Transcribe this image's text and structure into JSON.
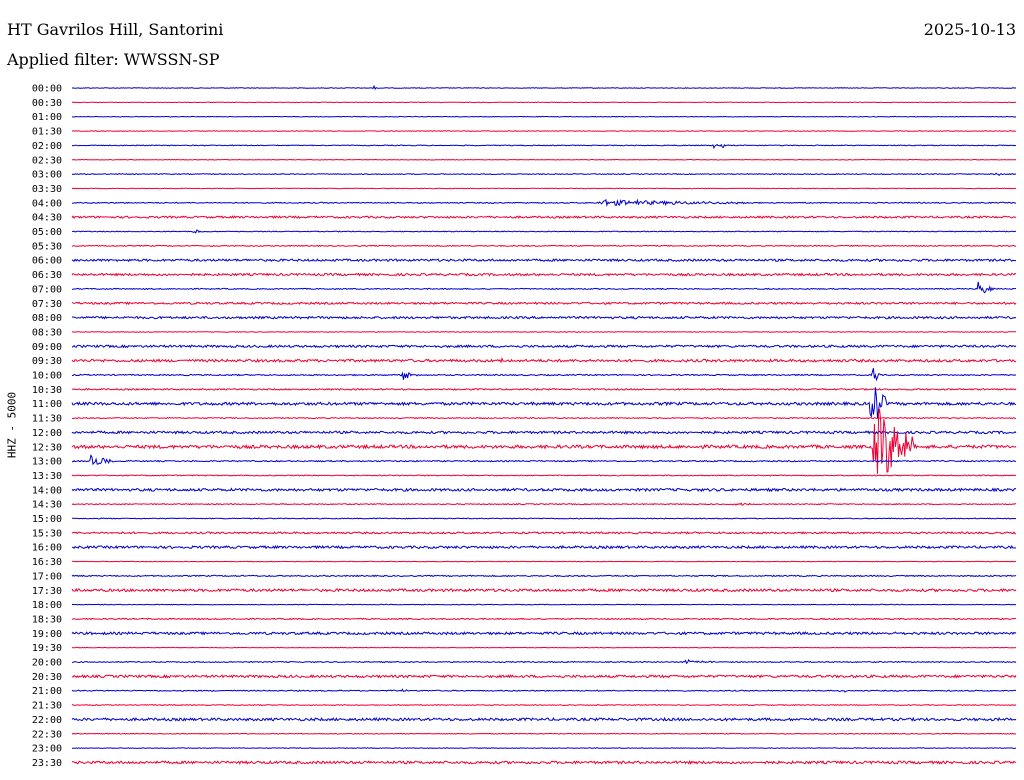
{
  "header": {
    "station": "HT Gavrilos Hill, Santorini",
    "date": "2025-10-13",
    "filter": "Applied filter: WWSSN-SP"
  },
  "chart_data": {
    "type": "line",
    "title": "HT Gavrilos Hill, Santorini",
    "ylabel": "HHZ - 5000",
    "colors": {
      "even": "#0000cc",
      "odd": "#ee0033"
    },
    "rows": [
      {
        "label": "00:00",
        "noise": 0.3,
        "events": [
          {
            "x": 0.32,
            "amp": 2,
            "dur": 0.005
          }
        ]
      },
      {
        "label": "00:30",
        "noise": 0.3,
        "events": []
      },
      {
        "label": "01:00",
        "noise": 0.3,
        "events": []
      },
      {
        "label": "01:30",
        "noise": 0.3,
        "events": []
      },
      {
        "label": "02:00",
        "noise": 0.4,
        "events": [
          {
            "x": 0.68,
            "amp": 3,
            "dur": 0.005
          },
          {
            "x": 0.688,
            "amp": 3,
            "dur": 0.005
          }
        ]
      },
      {
        "label": "02:30",
        "noise": 0.3,
        "events": []
      },
      {
        "label": "03:00",
        "noise": 0.4,
        "events": [
          {
            "x": 0.975,
            "amp": 3,
            "dur": 0.01
          }
        ]
      },
      {
        "label": "03:30",
        "noise": 0.3,
        "events": []
      },
      {
        "label": "04:00",
        "noise": 0.5,
        "events": [
          {
            "x": 0.56,
            "amp": 3,
            "dur": 0.16
          }
        ]
      },
      {
        "label": "04:30",
        "noise": 1.0,
        "events": []
      },
      {
        "label": "05:00",
        "noise": 0.4,
        "events": [
          {
            "x": 0.13,
            "amp": 3,
            "dur": 0.008
          }
        ]
      },
      {
        "label": "05:30",
        "noise": 0.5,
        "events": []
      },
      {
        "label": "06:00",
        "noise": 1.1,
        "events": []
      },
      {
        "label": "06:30",
        "noise": 1.1,
        "events": []
      },
      {
        "label": "07:00",
        "noise": 0.5,
        "events": [
          {
            "x": 0.96,
            "amp": 8,
            "dur": 0.015
          }
        ]
      },
      {
        "label": "07:30",
        "noise": 1.0,
        "events": []
      },
      {
        "label": "08:00",
        "noise": 1.1,
        "events": []
      },
      {
        "label": "08:30",
        "noise": 0.3,
        "events": []
      },
      {
        "label": "09:00",
        "noise": 1.1,
        "events": []
      },
      {
        "label": "09:30",
        "noise": 1.3,
        "events": [
          {
            "x": 0.455,
            "amp": 3,
            "dur": 0.005
          }
        ]
      },
      {
        "label": "10:00",
        "noise": 0.6,
        "events": [
          {
            "x": 0.35,
            "amp": 7,
            "dur": 0.012
          },
          {
            "x": 0.849,
            "amp": 28,
            "dur": 0.003
          }
        ]
      },
      {
        "label": "10:30",
        "noise": 0.7,
        "events": []
      },
      {
        "label": "11:00",
        "noise": 1.4,
        "events": [
          {
            "x": 0.847,
            "amp": 40,
            "dur": 0.012
          }
        ]
      },
      {
        "label": "11:30",
        "noise": 0.5,
        "events": []
      },
      {
        "label": "12:00",
        "noise": 1.2,
        "events": []
      },
      {
        "label": "12:30",
        "noise": 1.6,
        "events": [
          {
            "x": 0.85,
            "amp": 48,
            "dur": 0.04
          }
        ]
      },
      {
        "label": "13:00",
        "noise": 0.6,
        "events": [
          {
            "x": 0.02,
            "amp": 7,
            "dur": 0.02
          }
        ]
      },
      {
        "label": "13:30",
        "noise": 0.5,
        "events": []
      },
      {
        "label": "14:00",
        "noise": 1.3,
        "events": []
      },
      {
        "label": "14:30",
        "noise": 0.5,
        "events": [
          {
            "x": 0.7,
            "amp": 2,
            "dur": 0.02
          }
        ]
      },
      {
        "label": "15:00",
        "noise": 0.4,
        "events": []
      },
      {
        "label": "15:30",
        "noise": 0.9,
        "events": []
      },
      {
        "label": "16:00",
        "noise": 1.2,
        "events": []
      },
      {
        "label": "16:30",
        "noise": 0.3,
        "events": []
      },
      {
        "label": "17:00",
        "noise": 0.6,
        "events": []
      },
      {
        "label": "17:30",
        "noise": 1.3,
        "events": []
      },
      {
        "label": "18:00",
        "noise": 0.3,
        "events": []
      },
      {
        "label": "18:30",
        "noise": 0.6,
        "events": []
      },
      {
        "label": "19:00",
        "noise": 1.2,
        "events": []
      },
      {
        "label": "19:30",
        "noise": 0.3,
        "events": []
      },
      {
        "label": "20:00",
        "noise": 0.5,
        "events": [
          {
            "x": 0.65,
            "amp": 2,
            "dur": 0.03
          }
        ]
      },
      {
        "label": "20:30",
        "noise": 1.2,
        "events": []
      },
      {
        "label": "21:00",
        "noise": 0.5,
        "events": [
          {
            "x": 0.35,
            "amp": 2,
            "dur": 0.01
          },
          {
            "x": 0.815,
            "amp": 2,
            "dur": 0.01
          }
        ]
      },
      {
        "label": "21:30",
        "noise": 0.4,
        "events": []
      },
      {
        "label": "22:00",
        "noise": 1.3,
        "events": []
      },
      {
        "label": "22:30",
        "noise": 0.4,
        "events": []
      },
      {
        "label": "23:00",
        "noise": 0.3,
        "events": []
      },
      {
        "label": "23:30",
        "noise": 1.3,
        "events": []
      }
    ]
  }
}
